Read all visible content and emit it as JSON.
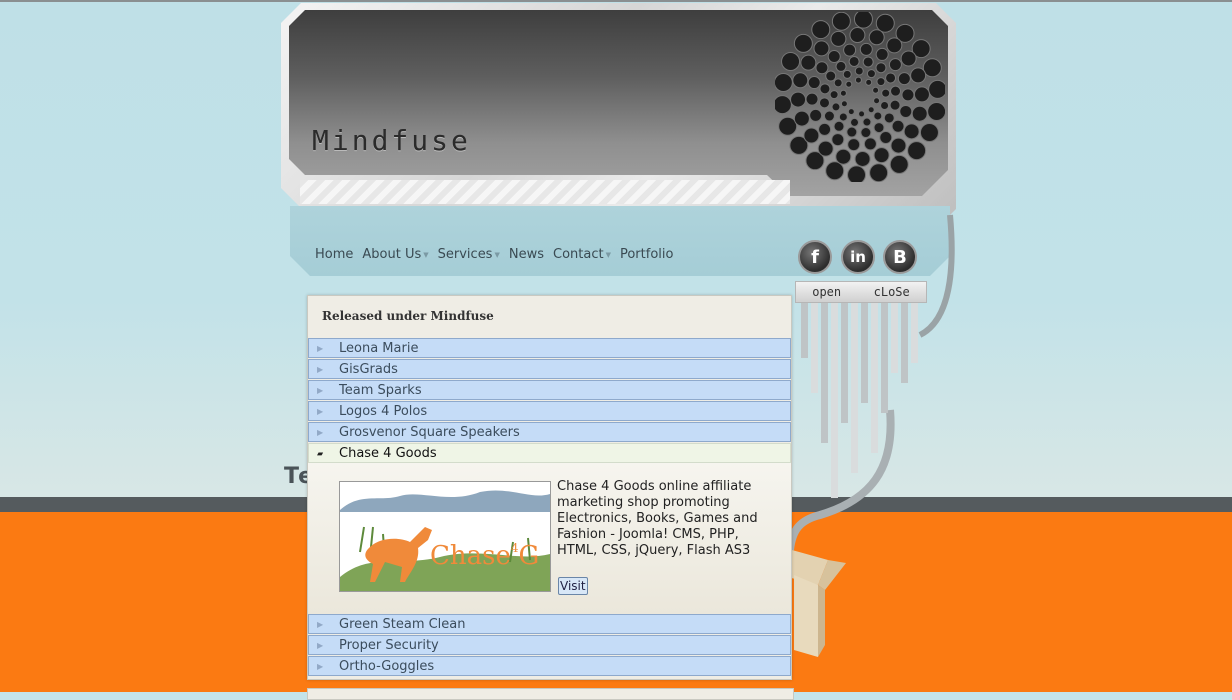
{
  "brand": {
    "logo_text": "Mindfuse"
  },
  "nav": [
    {
      "label": "Home",
      "dropdown": false
    },
    {
      "label": "About Us",
      "dropdown": true
    },
    {
      "label": "Services",
      "dropdown": true
    },
    {
      "label": "News",
      "dropdown": false
    },
    {
      "label": "Contact",
      "dropdown": true
    },
    {
      "label": "Portfolio",
      "dropdown": false
    }
  ],
  "social": [
    {
      "icon": "facebook-icon",
      "glyph": "f"
    },
    {
      "icon": "linkedin-icon",
      "glyph": "in"
    },
    {
      "icon": "blogger-icon",
      "glyph": "B"
    }
  ],
  "toggle": {
    "open_label": "open",
    "close_label": "cLoSe"
  },
  "partial_heading": "Te",
  "panel": {
    "title": "Released under Mindfuse",
    "items": [
      {
        "label": "Leona Marie"
      },
      {
        "label": "GisGrads"
      },
      {
        "label": "Team Sparks"
      },
      {
        "label": "Logos 4 Polos"
      },
      {
        "label": "Grosvenor Square Speakers"
      },
      {
        "label": "Chase 4 Goods"
      },
      {
        "label": "Green Steam Clean"
      },
      {
        "label": "Proper Security"
      },
      {
        "label": "Ortho-Goggles"
      }
    ],
    "active": {
      "index": 5,
      "description": "Chase 4 Goods online affiliate marketing shop promoting Electronics, Books, Games and Fashion - Joomla! CMS, PHP, HTML, CSS, jQuery, Flash AS3",
      "visit_label": "Visit",
      "thumb_text": "Chase",
      "thumb_sup": "4",
      "thumb_tail": "G"
    }
  },
  "colors": {
    "sky": "#c4e4ea",
    "orange": "#fb7a12",
    "accordion": "#c5dcf7",
    "accordion_active": "#eff5e6"
  }
}
